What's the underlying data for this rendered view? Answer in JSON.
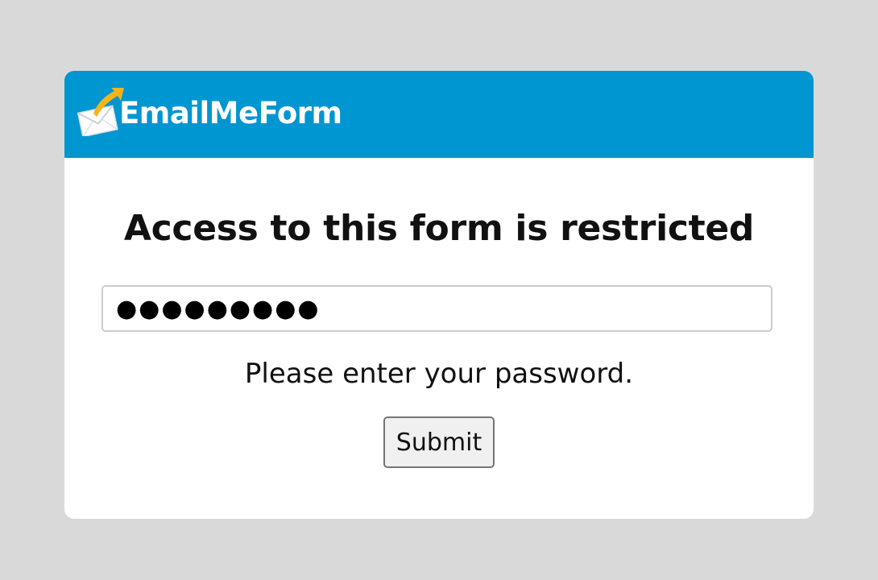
{
  "header": {
    "logo_text": "EmailMeForm",
    "logo_icon": "envelope-arrow-icon",
    "background_color": "#0096d1"
  },
  "main": {
    "title": "Access to this form is restricted",
    "password_field": {
      "value": "●●●●●●●●●",
      "type": "password"
    },
    "hint": "Please enter your password.",
    "submit_label": "Submit"
  },
  "colors": {
    "page_background": "#d9d9d9",
    "card_background": "#ffffff",
    "arrow_accent": "#f6b41a"
  }
}
